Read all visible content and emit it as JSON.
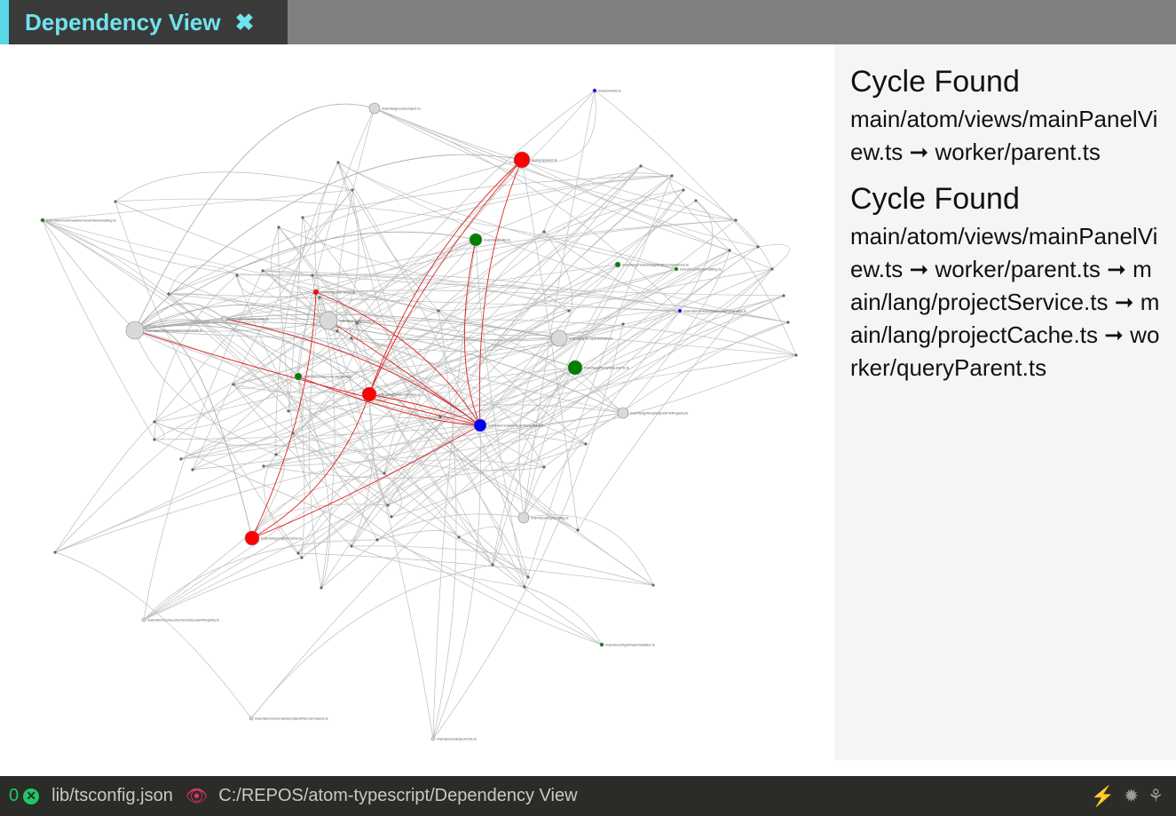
{
  "tab": {
    "title": "Dependency View"
  },
  "cycles": [
    {
      "heading": "Cycle Found",
      "path": "main/atom/views/mainPanelView.ts ➞ worker/parent.ts"
    },
    {
      "heading": "Cycle Found",
      "path": "main/atom/views/mainPanelView.ts ➞ worker/parent.ts ➞ main/lang/projectService.ts ➞ main/lang/projectCache.ts ➞ worker/queryParent.ts"
    }
  ],
  "statusbar": {
    "error_count": "0",
    "config_path": "lib/tsconfig.json",
    "view_path": "C:/REPOS/atom-typescript/Dependency View"
  },
  "colors": {
    "accent": "#6fe3ef",
    "node_cycle": "#ff0000",
    "node_main": "#0000ff",
    "node_group": "#008000",
    "node_default": "#cccccc"
  },
  "graph": {
    "nodes": [
      {
        "id": "n1",
        "label": "main/atom/commands/commands.ts",
        "color": "#d9d9d9",
        "r": 10
      },
      {
        "id": "n2",
        "label": "main/lang/core/project.ts",
        "color": "#d9d9d9",
        "r": 6
      },
      {
        "id": "n3",
        "label": "worker/parent.ts",
        "color": "#ff0000",
        "r": 9
      },
      {
        "id": "n4",
        "label": "worker/child.ts",
        "color": "#0000ff",
        "r": 2
      },
      {
        "id": "n5",
        "label": "main/lang/utils.ts",
        "color": "#008000",
        "r": 7
      },
      {
        "id": "n6",
        "label": "main/atom/atomConfig.ts",
        "color": "#d9d9d9",
        "r": 3
      },
      {
        "id": "n7",
        "label": "main/atom/atomUtils.ts",
        "color": "#d9d9d9",
        "r": 10
      },
      {
        "id": "n8",
        "label": "main/lang/projectService.ts",
        "color": "#ff0000",
        "r": 8
      },
      {
        "id": "n9",
        "label": "main/atom/views/mainPanelView.ts",
        "color": "#0000ff",
        "r": 7
      },
      {
        "id": "n10",
        "label": "main/atom/views/tooltipView.ts",
        "color": "#008000",
        "r": 4
      },
      {
        "id": "n11",
        "label": "main/lang/fixmyts/astUtils.ts",
        "color": "#d9d9d9",
        "r": 9
      },
      {
        "id": "n12",
        "label": "main/lang/fixmyts/quickFix.ts",
        "color": "#008000",
        "r": 8
      },
      {
        "id": "n13",
        "label": "main/lang/fixmyts/quickFixRegistry.ts",
        "color": "#d9d9d9",
        "r": 6
      },
      {
        "id": "n14",
        "label": "main/lang/projectCache.ts",
        "color": "#ff0000",
        "r": 8
      },
      {
        "id": "n15",
        "label": "main/tsconfig/tsconfig.ts",
        "color": "#d9d9d9",
        "r": 6
      },
      {
        "id": "n16",
        "label": "main/lang/modules/getPathCompletions.ts",
        "color": "#008000",
        "r": 3
      },
      {
        "id": "n17",
        "label": "worker/queryParent.ts",
        "color": "#ff0000",
        "r": 3
      },
      {
        "id": "n18",
        "label": "main/tsconfig/formatting.ts",
        "color": "#008000",
        "r": 2
      },
      {
        "id": "n19",
        "label": "main/atom/views/awesomePanelView.ts",
        "color": "#0000ff",
        "r": 2
      },
      {
        "id": "n20",
        "label": "main/atom/commands/moveFilesHandling.ts",
        "color": "#008000",
        "r": 2
      },
      {
        "id": "n21",
        "label": "main/tsconfig/simpleValidator.ts",
        "color": "#008000",
        "r": 2
      },
      {
        "id": "n22",
        "label": "main/json2dts/json2dts.ts",
        "color": "#d9d9d9",
        "r": 2
      },
      {
        "id": "n23",
        "label": "main/atom/commands/outputFileCommands.ts",
        "color": "#d9d9d9",
        "r": 2
      },
      {
        "id": "n24",
        "label": "main/atom/components/componentRegistry.ts",
        "color": "#d9d9d9",
        "r": 2
      }
    ]
  }
}
